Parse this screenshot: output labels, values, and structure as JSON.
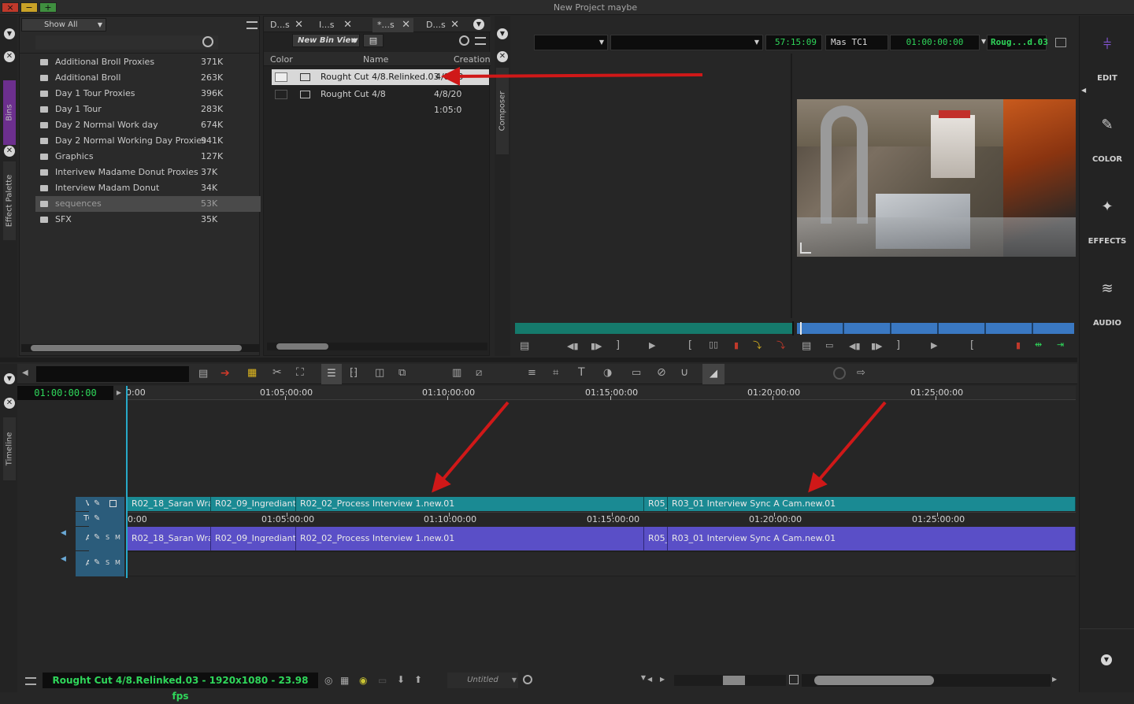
{
  "window": {
    "title": "New Project maybe",
    "buttons": [
      "×",
      "−",
      "+"
    ]
  },
  "sidebar_tabs": {
    "bins": "Bins",
    "effect_palette": "Effect Palette",
    "timeline": "Timeline",
    "composer": "Composer"
  },
  "bin_list": {
    "show_all": "Show All",
    "items": [
      {
        "name": "Additional Broll Proxies",
        "size": "371K"
      },
      {
        "name": "Additional Broll",
        "size": "263K"
      },
      {
        "name": "Day 1 Tour Proxies",
        "size": "396K"
      },
      {
        "name": "Day 1 Tour",
        "size": "283K"
      },
      {
        "name": "Day 2 Normal Work day",
        "size": "674K"
      },
      {
        "name": "Day 2 Normal Working Day Proxies",
        "size": "941K"
      },
      {
        "name": "Graphics",
        "size": "127K"
      },
      {
        "name": "Interivew Madame Donut Proxies",
        "size": "37K"
      },
      {
        "name": "Interview Madam Donut",
        "size": "34K"
      },
      {
        "name": "sequences",
        "size": "53K"
      },
      {
        "name": "SFX",
        "size": "35K"
      }
    ]
  },
  "bin_panel": {
    "tabs": [
      "D...s",
      "I...s",
      "*...s",
      "D...s"
    ],
    "view_name": "New Bin View",
    "columns": {
      "color": "Color",
      "name": "Name",
      "creation": "Creation"
    },
    "rows": [
      {
        "name": "Rought Cut 4/8.Relinked.03",
        "creation": "4/8/20 1:05:2"
      },
      {
        "name": "Rought Cut 4/8",
        "creation": "4/8/20 1:05:0"
      }
    ]
  },
  "composer": {
    "timecode_duration": "57:15:09",
    "tc_label": "Mas  TC1",
    "timecode_master": "01:00:00:00",
    "sequence_short": "Roug...d.03"
  },
  "right_toolbar": {
    "edit": "EDIT",
    "color": "COLOR",
    "effects": "EFFECTS",
    "audio": "AUDIO"
  },
  "timeline": {
    "timecode": "01:00:00:00",
    "ruler": [
      "0:00",
      "01:05:00:00",
      "01:10:00:00",
      "01:15:00:00",
      "01:20:00:00",
      "01:25:00:00"
    ],
    "tracks": {
      "v1": "V1",
      "tc1": "TC1",
      "a1": "A1",
      "a2": "A2",
      "s": "S",
      "m": "M"
    },
    "v1_clips": [
      "R02_18_Saran Wrap",
      "R02_09_Ingrediants.",
      "R02_02_Process Interview 1.new.01",
      "R05_",
      "R03_01 Interview Sync A Cam.new.01"
    ],
    "a1_clips": [
      "R02_18_Saran Wrap",
      "R02_09_Ingrediants.",
      "R02_02_Process Interview 1.new.01",
      "R05_",
      "R03_01 Interview Sync A Cam.new.01"
    ],
    "tc_ruler": [
      "0:00",
      "01:05:00:00",
      "01:10:00:00",
      "01:15:00:00",
      "01:20:00:00",
      "01:25:00:00"
    ]
  },
  "status": {
    "sequence_info": "Rought Cut 4/8.Relinked.03 - 1920x1080 - 23.98 fps",
    "untitled": "Untitled"
  },
  "colors": {
    "video_clip": "#1a8a93",
    "audio_clip": "#5a4fc7",
    "timecode_green": "#2fd65a",
    "annotation_arrow": "#d01818",
    "bins_tab": "#6c2f8e"
  }
}
